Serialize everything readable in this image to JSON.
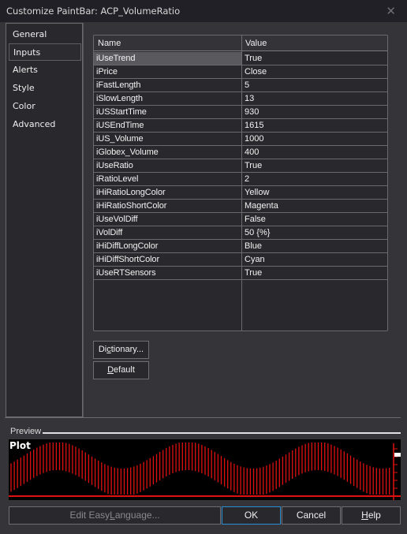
{
  "window": {
    "title": "Customize PaintBar: ACP_VolumeRatio",
    "close_icon": "close-icon"
  },
  "sidebar": {
    "items": [
      {
        "label": "General",
        "selected": false
      },
      {
        "label": "Inputs",
        "selected": true
      },
      {
        "label": "Alerts",
        "selected": false
      },
      {
        "label": "Style",
        "selected": false
      },
      {
        "label": "Color",
        "selected": false
      },
      {
        "label": "Advanced",
        "selected": false
      }
    ]
  },
  "inputs_grid": {
    "columns": [
      "Name",
      "Value"
    ],
    "selected_row": 0,
    "rows": [
      {
        "name": "iUseTrend",
        "value": "True"
      },
      {
        "name": "iPrice",
        "value": "Close"
      },
      {
        "name": "iFastLength",
        "value": "5"
      },
      {
        "name": "iSlowLength",
        "value": "13"
      },
      {
        "name": "iUSStartTime",
        "value": "930"
      },
      {
        "name": "iUSEndTime",
        "value": "1615"
      },
      {
        "name": "iUS_Volume",
        "value": "1000"
      },
      {
        "name": "iGlobex_Volume",
        "value": "400"
      },
      {
        "name": "iUseRatio",
        "value": "True"
      },
      {
        "name": "iRatioLevel",
        "value": "2"
      },
      {
        "name": "iHiRatioLongColor",
        "value": "Yellow"
      },
      {
        "name": "iHiRatioShortColor",
        "value": "Magenta"
      },
      {
        "name": "iUseVolDiff",
        "value": "False"
      },
      {
        "name": "iVolDiff",
        "value": "50 {%}"
      },
      {
        "name": "iHiDiffLongColor",
        "value": "Blue"
      },
      {
        "name": "iHiDiffShortColor",
        "value": "Cyan"
      },
      {
        "name": "iUseRTSensors",
        "value": "True"
      }
    ]
  },
  "buttons": {
    "dictionary": {
      "pre": "Di",
      "mnemonic": "c",
      "post": "tionary..."
    },
    "default": {
      "pre": "",
      "mnemonic": "D",
      "post": "efault"
    },
    "edit_easylanguage": {
      "pre": "Edit Easy",
      "mnemonic": "L",
      "post": "anguage..."
    },
    "ok": "OK",
    "cancel": "Cancel",
    "help": {
      "pre": "",
      "mnemonic": "H",
      "post": "elp"
    }
  },
  "preview": {
    "label": "Preview",
    "plot_label": "Plot",
    "plot_color": "#e01010",
    "background_color": "#000000"
  }
}
